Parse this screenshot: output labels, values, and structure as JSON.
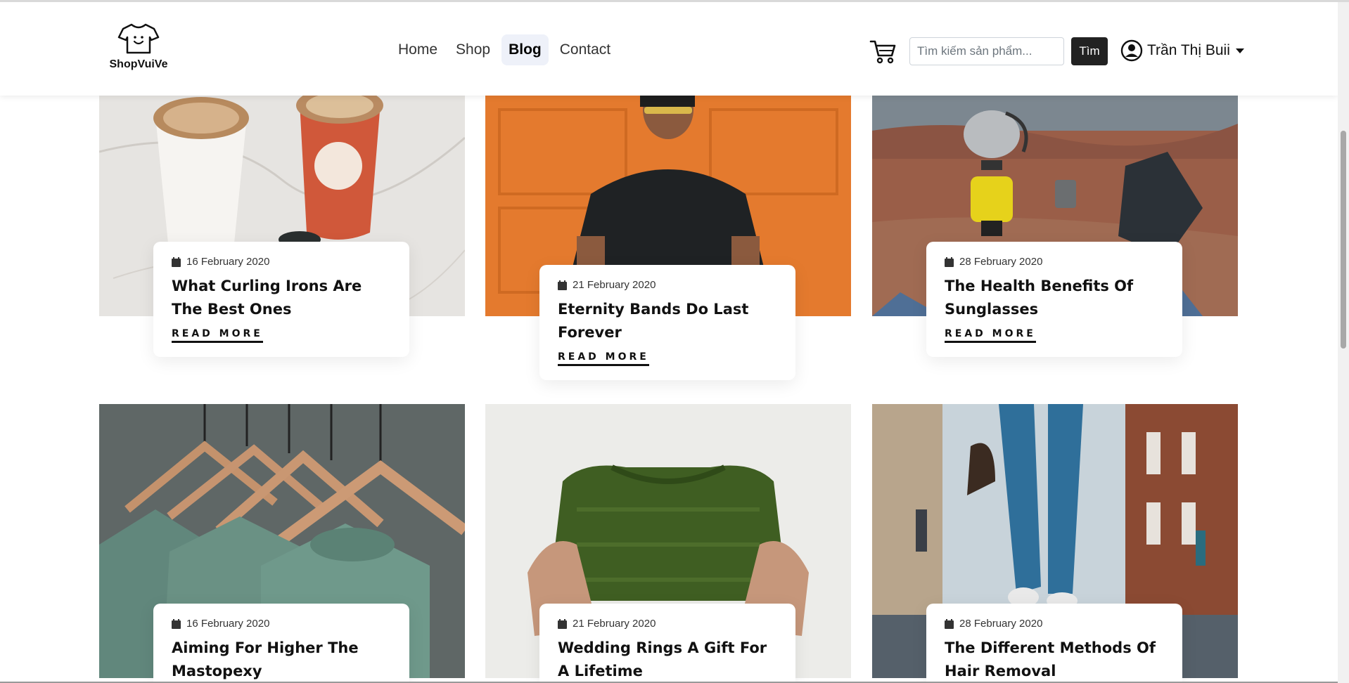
{
  "brand": {
    "name": "ShopVuiVe"
  },
  "nav": {
    "links": [
      {
        "label": "Home"
      },
      {
        "label": "Shop"
      },
      {
        "label": "Blog"
      },
      {
        "label": "Contact"
      }
    ],
    "active": "Blog"
  },
  "search": {
    "placeholder": "Tìm kiếm sản phẩm...",
    "button_label": "Tìm"
  },
  "user": {
    "name": "Trần Thị Buii"
  },
  "posts": [
    {
      "date": "16 February 2020",
      "title": "What Curling Irons Are The Best Ones",
      "read_more": "READ MORE"
    },
    {
      "date": "21 February 2020",
      "title": "Eternity Bands Do Last Forever",
      "read_more": "READ MORE"
    },
    {
      "date": "28 February 2020",
      "title": "The Health Benefits Of Sunglasses",
      "read_more": "READ MORE"
    },
    {
      "date": "16 February 2020",
      "title": "Aiming For Higher The Mastopexy"
    },
    {
      "date": "21 February 2020",
      "title": "Wedding Rings A Gift For A Lifetime"
    },
    {
      "date": "28 February 2020",
      "title": "The Different Methods Of Hair Removal"
    }
  ],
  "icons": {
    "logo": "tshirt-smile-icon",
    "cart": "cart-icon",
    "user": "user-circle-icon",
    "date": "calendar-icon"
  }
}
